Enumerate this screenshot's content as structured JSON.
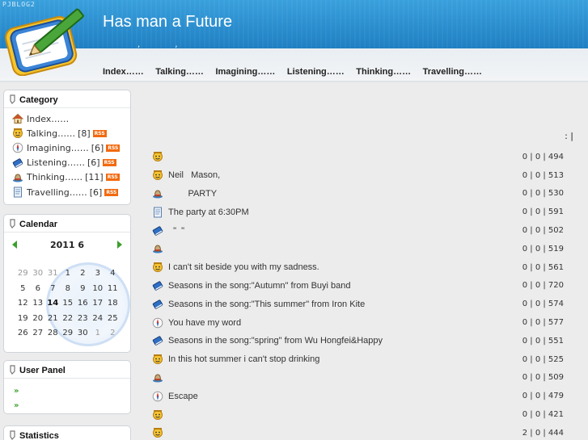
{
  "header": {
    "brand": "PJBLOG2",
    "title": "Has man a Future",
    "subtitle_marks": [
      ",",
      ","
    ]
  },
  "nav": [
    "Index……",
    "Talking……",
    "Imagining……",
    "Listening……",
    "Thinking……",
    "Travelling……"
  ],
  "category": {
    "title": "Category",
    "rss_label": "RSS",
    "items": [
      {
        "label": "Index……",
        "count": "",
        "rss": false,
        "icon": "home-icon"
      },
      {
        "label": "Talking……",
        "count": "[8]",
        "rss": true,
        "icon": "smiley-icon"
      },
      {
        "label": "Imagining……",
        "count": "[6]",
        "rss": true,
        "icon": "compass-icon"
      },
      {
        "label": "Listening……",
        "count": "[6]",
        "rss": true,
        "icon": "book-icon"
      },
      {
        "label": "Thinking……",
        "count": "[11]",
        "rss": true,
        "icon": "hat-icon"
      },
      {
        "label": "Travelling……",
        "count": "[6]",
        "rss": true,
        "icon": "document-icon"
      }
    ]
  },
  "calendar": {
    "title": "Calendar",
    "month": "2011 6",
    "today": "14",
    "days": [
      {
        "d": "29",
        "dim": true
      },
      {
        "d": "30",
        "dim": true
      },
      {
        "d": "31",
        "dim": true
      },
      {
        "d": "1"
      },
      {
        "d": "2"
      },
      {
        "d": "3"
      },
      {
        "d": "4"
      },
      {
        "d": "5"
      },
      {
        "d": "6"
      },
      {
        "d": "7"
      },
      {
        "d": "8"
      },
      {
        "d": "9"
      },
      {
        "d": "10"
      },
      {
        "d": "11"
      },
      {
        "d": "12"
      },
      {
        "d": "13"
      },
      {
        "d": "14"
      },
      {
        "d": "15"
      },
      {
        "d": "16"
      },
      {
        "d": "17"
      },
      {
        "d": "18"
      },
      {
        "d": "19"
      },
      {
        "d": "20"
      },
      {
        "d": "21"
      },
      {
        "d": "22"
      },
      {
        "d": "23"
      },
      {
        "d": "24"
      },
      {
        "d": "25"
      },
      {
        "d": "26"
      },
      {
        "d": "27"
      },
      {
        "d": "28"
      },
      {
        "d": "29"
      },
      {
        "d": "30"
      },
      {
        "d": "1",
        "dim": true
      },
      {
        "d": "2",
        "dim": true
      }
    ]
  },
  "user_panel": {
    "title": "User Panel",
    "items": [
      "",
      ""
    ]
  },
  "statistics": {
    "title": "Statistics"
  },
  "main": {
    "header_mark": ":   |",
    "posts": [
      {
        "icon": "smiley-icon",
        "title": "",
        "stats": "0 | 0 | 494"
      },
      {
        "icon": "smiley-icon",
        "title": "Neil   Mason,",
        "stats": "0 | 0 | 513"
      },
      {
        "icon": "hat-icon",
        "title": "        PARTY",
        "stats": "0 | 0 | 530"
      },
      {
        "icon": "document-icon",
        "title": "The party at 6:30PM",
        "stats": "0 | 0 | 591"
      },
      {
        "icon": "book-icon",
        "title": "  \"  \"",
        "stats": "0 | 0 | 502"
      },
      {
        "icon": "hat-icon",
        "title": "",
        "stats": "0 | 0 | 519"
      },
      {
        "icon": "smiley-icon",
        "title": "I can't sit beside you with my sadness.",
        "stats": "0 | 0 | 561"
      },
      {
        "icon": "book-icon",
        "title": "Seasons in the song:\"Autumn\" from Buyi band",
        "stats": "0 | 0 | 720"
      },
      {
        "icon": "book-icon",
        "title": "Seasons in the song:\"This summer\" from Iron Kite",
        "stats": "0 | 0 | 574"
      },
      {
        "icon": "compass-icon",
        "title": "You have my word",
        "stats": "0 | 0 | 577"
      },
      {
        "icon": "book-icon",
        "title": "Seasons in the song:\"spring\" from Wu Hongfei&Happy",
        "stats": "0 | 0 | 551"
      },
      {
        "icon": "smiley-icon",
        "title": "In this hot summer i can't stop drinking",
        "stats": "0 | 0 | 525"
      },
      {
        "icon": "hat-icon",
        "title": "",
        "stats": "0 | 0 | 509"
      },
      {
        "icon": "compass-icon",
        "title": "Escape",
        "stats": "0 | 0 | 479"
      },
      {
        "icon": "smiley-icon",
        "title": "",
        "stats": "0 | 0 | 421"
      },
      {
        "icon": "smiley-icon",
        "title": "",
        "stats": "2 | 0 | 444"
      }
    ]
  },
  "colors": {
    "header_blue": "#2a86c8",
    "rss_orange": "#f26a0f",
    "arrow_green": "#3aa02a"
  }
}
